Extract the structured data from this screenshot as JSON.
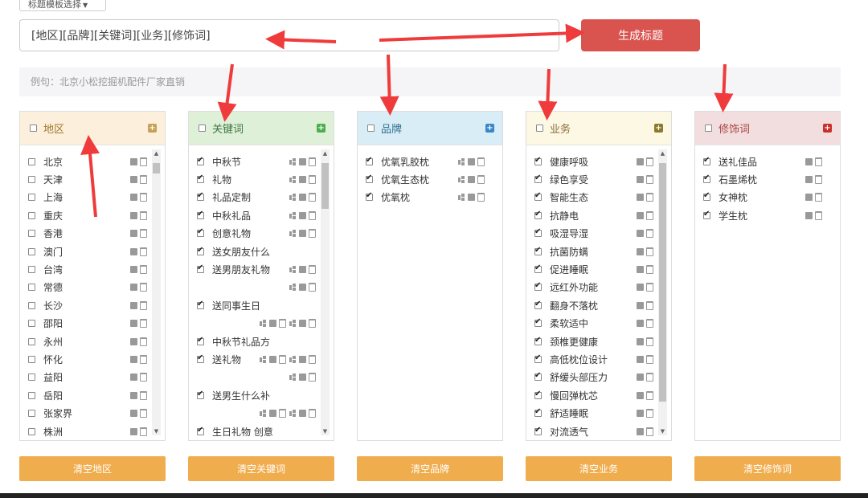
{
  "template_select": {
    "label": "标题模板选择"
  },
  "title_input": {
    "value": "[地区][品牌][关键词][业务][修饰词]"
  },
  "generate_button": {
    "label": "生成标题"
  },
  "example": {
    "text": "例句：北京小松挖掘机配件厂家直销"
  },
  "colors": {
    "danger": "#d9534f",
    "warning": "#f0ad4e",
    "annotation_arrow": "#ef3b3b"
  },
  "panels": [
    {
      "id": "region",
      "title": "地区",
      "header_bg": "#fcf0dc",
      "title_color": "#a0782c",
      "add_color": "#c7a155",
      "clear_label": "清空地区",
      "scroll": {
        "visible": true,
        "thumb_start": 0.02,
        "thumb_len": 0.04
      },
      "items": [
        {
          "text": "北京",
          "checked": false,
          "icons": [
            "edit-icon",
            "trash-icon"
          ]
        },
        {
          "text": "天津",
          "checked": false,
          "icons": [
            "edit-icon",
            "trash-icon"
          ]
        },
        {
          "text": "上海",
          "checked": false,
          "icons": [
            "edit-icon",
            "trash-icon"
          ]
        },
        {
          "text": "重庆",
          "checked": false,
          "icons": [
            "edit-icon",
            "trash-icon"
          ]
        },
        {
          "text": "香港",
          "checked": false,
          "icons": [
            "edit-icon",
            "trash-icon"
          ]
        },
        {
          "text": "澳门",
          "checked": false,
          "icons": [
            "edit-icon",
            "trash-icon"
          ]
        },
        {
          "text": "台湾",
          "checked": false,
          "icons": [
            "edit-icon",
            "trash-icon"
          ]
        },
        {
          "text": "常德",
          "checked": false,
          "icons": [
            "edit-icon",
            "trash-icon"
          ]
        },
        {
          "text": "长沙",
          "checked": false,
          "icons": [
            "edit-icon",
            "trash-icon"
          ]
        },
        {
          "text": "邵阳",
          "checked": false,
          "icons": [
            "edit-icon",
            "trash-icon"
          ]
        },
        {
          "text": "永州",
          "checked": false,
          "icons": [
            "edit-icon",
            "trash-icon"
          ]
        },
        {
          "text": "怀化",
          "checked": false,
          "icons": [
            "edit-icon",
            "trash-icon"
          ]
        },
        {
          "text": "益阳",
          "checked": false,
          "icons": [
            "edit-icon",
            "trash-icon"
          ]
        },
        {
          "text": "岳阳",
          "checked": false,
          "icons": [
            "edit-icon",
            "trash-icon"
          ]
        },
        {
          "text": "张家界",
          "checked": false,
          "icons": [
            "edit-icon",
            "trash-icon"
          ]
        },
        {
          "text": "株洲",
          "checked": false,
          "icons": [
            "edit-icon",
            "trash-icon"
          ]
        }
      ]
    },
    {
      "id": "keyword",
      "title": "关键词",
      "header_bg": "#dff0d8",
      "title_color": "#3c763d",
      "add_color": "#4cae4c",
      "clear_label": "清空关键词",
      "scroll": {
        "visible": true,
        "thumb_start": 0.02,
        "thumb_len": 0.17
      },
      "items": [
        {
          "text": "中秋节",
          "checked": true,
          "icons": [
            "sitemap-icon",
            "edit-icon",
            "trash-icon"
          ]
        },
        {
          "text": "礼物",
          "checked": true,
          "icons": [
            "sitemap-icon",
            "edit-icon",
            "trash-icon"
          ]
        },
        {
          "text": "礼品定制",
          "checked": true,
          "icons": [
            "sitemap-icon",
            "edit-icon",
            "trash-icon"
          ]
        },
        {
          "text": "中秋礼品",
          "checked": true,
          "icons": [
            "sitemap-icon",
            "edit-icon",
            "trash-icon"
          ]
        },
        {
          "text": "创意礼物",
          "checked": true,
          "icons": [
            "sitemap-icon",
            "edit-icon",
            "trash-icon"
          ]
        },
        {
          "text": "送女朋友什么",
          "checked": true,
          "icons": []
        },
        {
          "text": "送男朋友礼物",
          "checked": true,
          "icons": [
            "sitemap-icon",
            "edit-icon",
            "trash-icon"
          ]
        },
        {
          "text": "",
          "checked": null,
          "icons": [
            "sitemap-icon",
            "edit-icon",
            "trash-icon"
          ]
        },
        {
          "text": "送同事生日",
          "checked": true,
          "icons": []
        },
        {
          "text": "",
          "checked": null,
          "icons": [
            "sitemap-icon",
            "edit-icon",
            "trash-icon",
            "sitemap-icon",
            "edit-icon",
            "trash-icon"
          ]
        },
        {
          "text": "中秋节礼品方",
          "checked": true,
          "icons": []
        },
        {
          "text": "送礼物",
          "checked": true,
          "icons": [
            "sitemap-icon",
            "edit-icon",
            "trash-icon",
            "sitemap-icon",
            "edit-icon",
            "trash-icon"
          ]
        },
        {
          "text": "",
          "checked": null,
          "icons": [
            "sitemap-icon",
            "edit-icon",
            "trash-icon"
          ]
        },
        {
          "text": "送男生什么补",
          "checked": true,
          "icons": []
        },
        {
          "text": "",
          "checked": null,
          "icons": [
            "sitemap-icon",
            "edit-icon",
            "trash-icon",
            "sitemap-icon",
            "edit-icon",
            "trash-icon"
          ]
        },
        {
          "text": "生日礼物 创意",
          "checked": true,
          "icons": []
        }
      ]
    },
    {
      "id": "brand",
      "title": "品牌",
      "header_bg": "#d9edf7",
      "title_color": "#31708f",
      "add_color": "#3a87c8",
      "clear_label": "清空品牌",
      "scroll": {
        "visible": false
      },
      "items": [
        {
          "text": "优氧乳胶枕",
          "checked": true,
          "icons": [
            "sitemap-icon",
            "edit-icon",
            "trash-icon"
          ]
        },
        {
          "text": "优氧生态枕",
          "checked": true,
          "icons": [
            "sitemap-icon",
            "edit-icon",
            "trash-icon"
          ]
        },
        {
          "text": "优氧枕",
          "checked": true,
          "icons": [
            "sitemap-icon",
            "edit-icon",
            "trash-icon"
          ]
        }
      ]
    },
    {
      "id": "business",
      "title": "业务",
      "header_bg": "#fcf8e3",
      "title_color": "#8a6d3b",
      "add_color": "#8a7a2b",
      "clear_label": "清空业务",
      "scroll": {
        "visible": true,
        "thumb_start": 0.02,
        "thumb_len": 0.88
      },
      "items": [
        {
          "text": "健康呼吸",
          "checked": true,
          "icons": [
            "edit-icon",
            "trash-icon"
          ]
        },
        {
          "text": "绿色享受",
          "checked": true,
          "icons": [
            "edit-icon",
            "trash-icon"
          ]
        },
        {
          "text": "智能生态",
          "checked": true,
          "icons": [
            "edit-icon",
            "trash-icon"
          ]
        },
        {
          "text": "抗静电",
          "checked": true,
          "icons": [
            "edit-icon",
            "trash-icon"
          ]
        },
        {
          "text": "吸湿导湿",
          "checked": true,
          "icons": [
            "edit-icon",
            "trash-icon"
          ]
        },
        {
          "text": "抗菌防螨",
          "checked": true,
          "icons": [
            "edit-icon",
            "trash-icon"
          ]
        },
        {
          "text": "促进睡眠",
          "checked": true,
          "icons": [
            "edit-icon",
            "trash-icon"
          ]
        },
        {
          "text": "远红外功能",
          "checked": true,
          "icons": [
            "edit-icon",
            "trash-icon"
          ]
        },
        {
          "text": "翻身不落枕",
          "checked": true,
          "icons": [
            "edit-icon",
            "trash-icon"
          ]
        },
        {
          "text": "柔软适中",
          "checked": true,
          "icons": [
            "edit-icon",
            "trash-icon"
          ]
        },
        {
          "text": "颈椎更健康",
          "checked": true,
          "icons": [
            "edit-icon",
            "trash-icon"
          ]
        },
        {
          "text": "高低枕位设计",
          "checked": true,
          "icons": [
            "edit-icon",
            "trash-icon"
          ]
        },
        {
          "text": "舒缓头部压力",
          "checked": true,
          "icons": [
            "edit-icon",
            "trash-icon"
          ]
        },
        {
          "text": "慢回弹枕芯",
          "checked": true,
          "icons": [
            "edit-icon",
            "trash-icon"
          ]
        },
        {
          "text": "舒适睡眠",
          "checked": true,
          "icons": [
            "edit-icon",
            "trash-icon"
          ]
        },
        {
          "text": "对流透气",
          "checked": true,
          "icons": [
            "edit-icon",
            "trash-icon"
          ]
        }
      ]
    },
    {
      "id": "modifier",
      "title": "修饰词",
      "header_bg": "#f2dede",
      "title_color": "#a94442",
      "add_color": "#c9302c",
      "clear_label": "清空修饰词",
      "scroll": {
        "visible": false
      },
      "items": [
        {
          "text": "送礼佳品",
          "checked": true,
          "icons": [
            "edit-icon",
            "trash-icon"
          ]
        },
        {
          "text": "石墨烯枕",
          "checked": true,
          "icons": [
            "edit-icon",
            "trash-icon"
          ]
        },
        {
          "text": "女神枕",
          "checked": true,
          "icons": [
            "edit-icon",
            "trash-icon"
          ]
        },
        {
          "text": "学生枕",
          "checked": true,
          "icons": [
            "edit-icon",
            "trash-icon"
          ]
        }
      ]
    }
  ]
}
